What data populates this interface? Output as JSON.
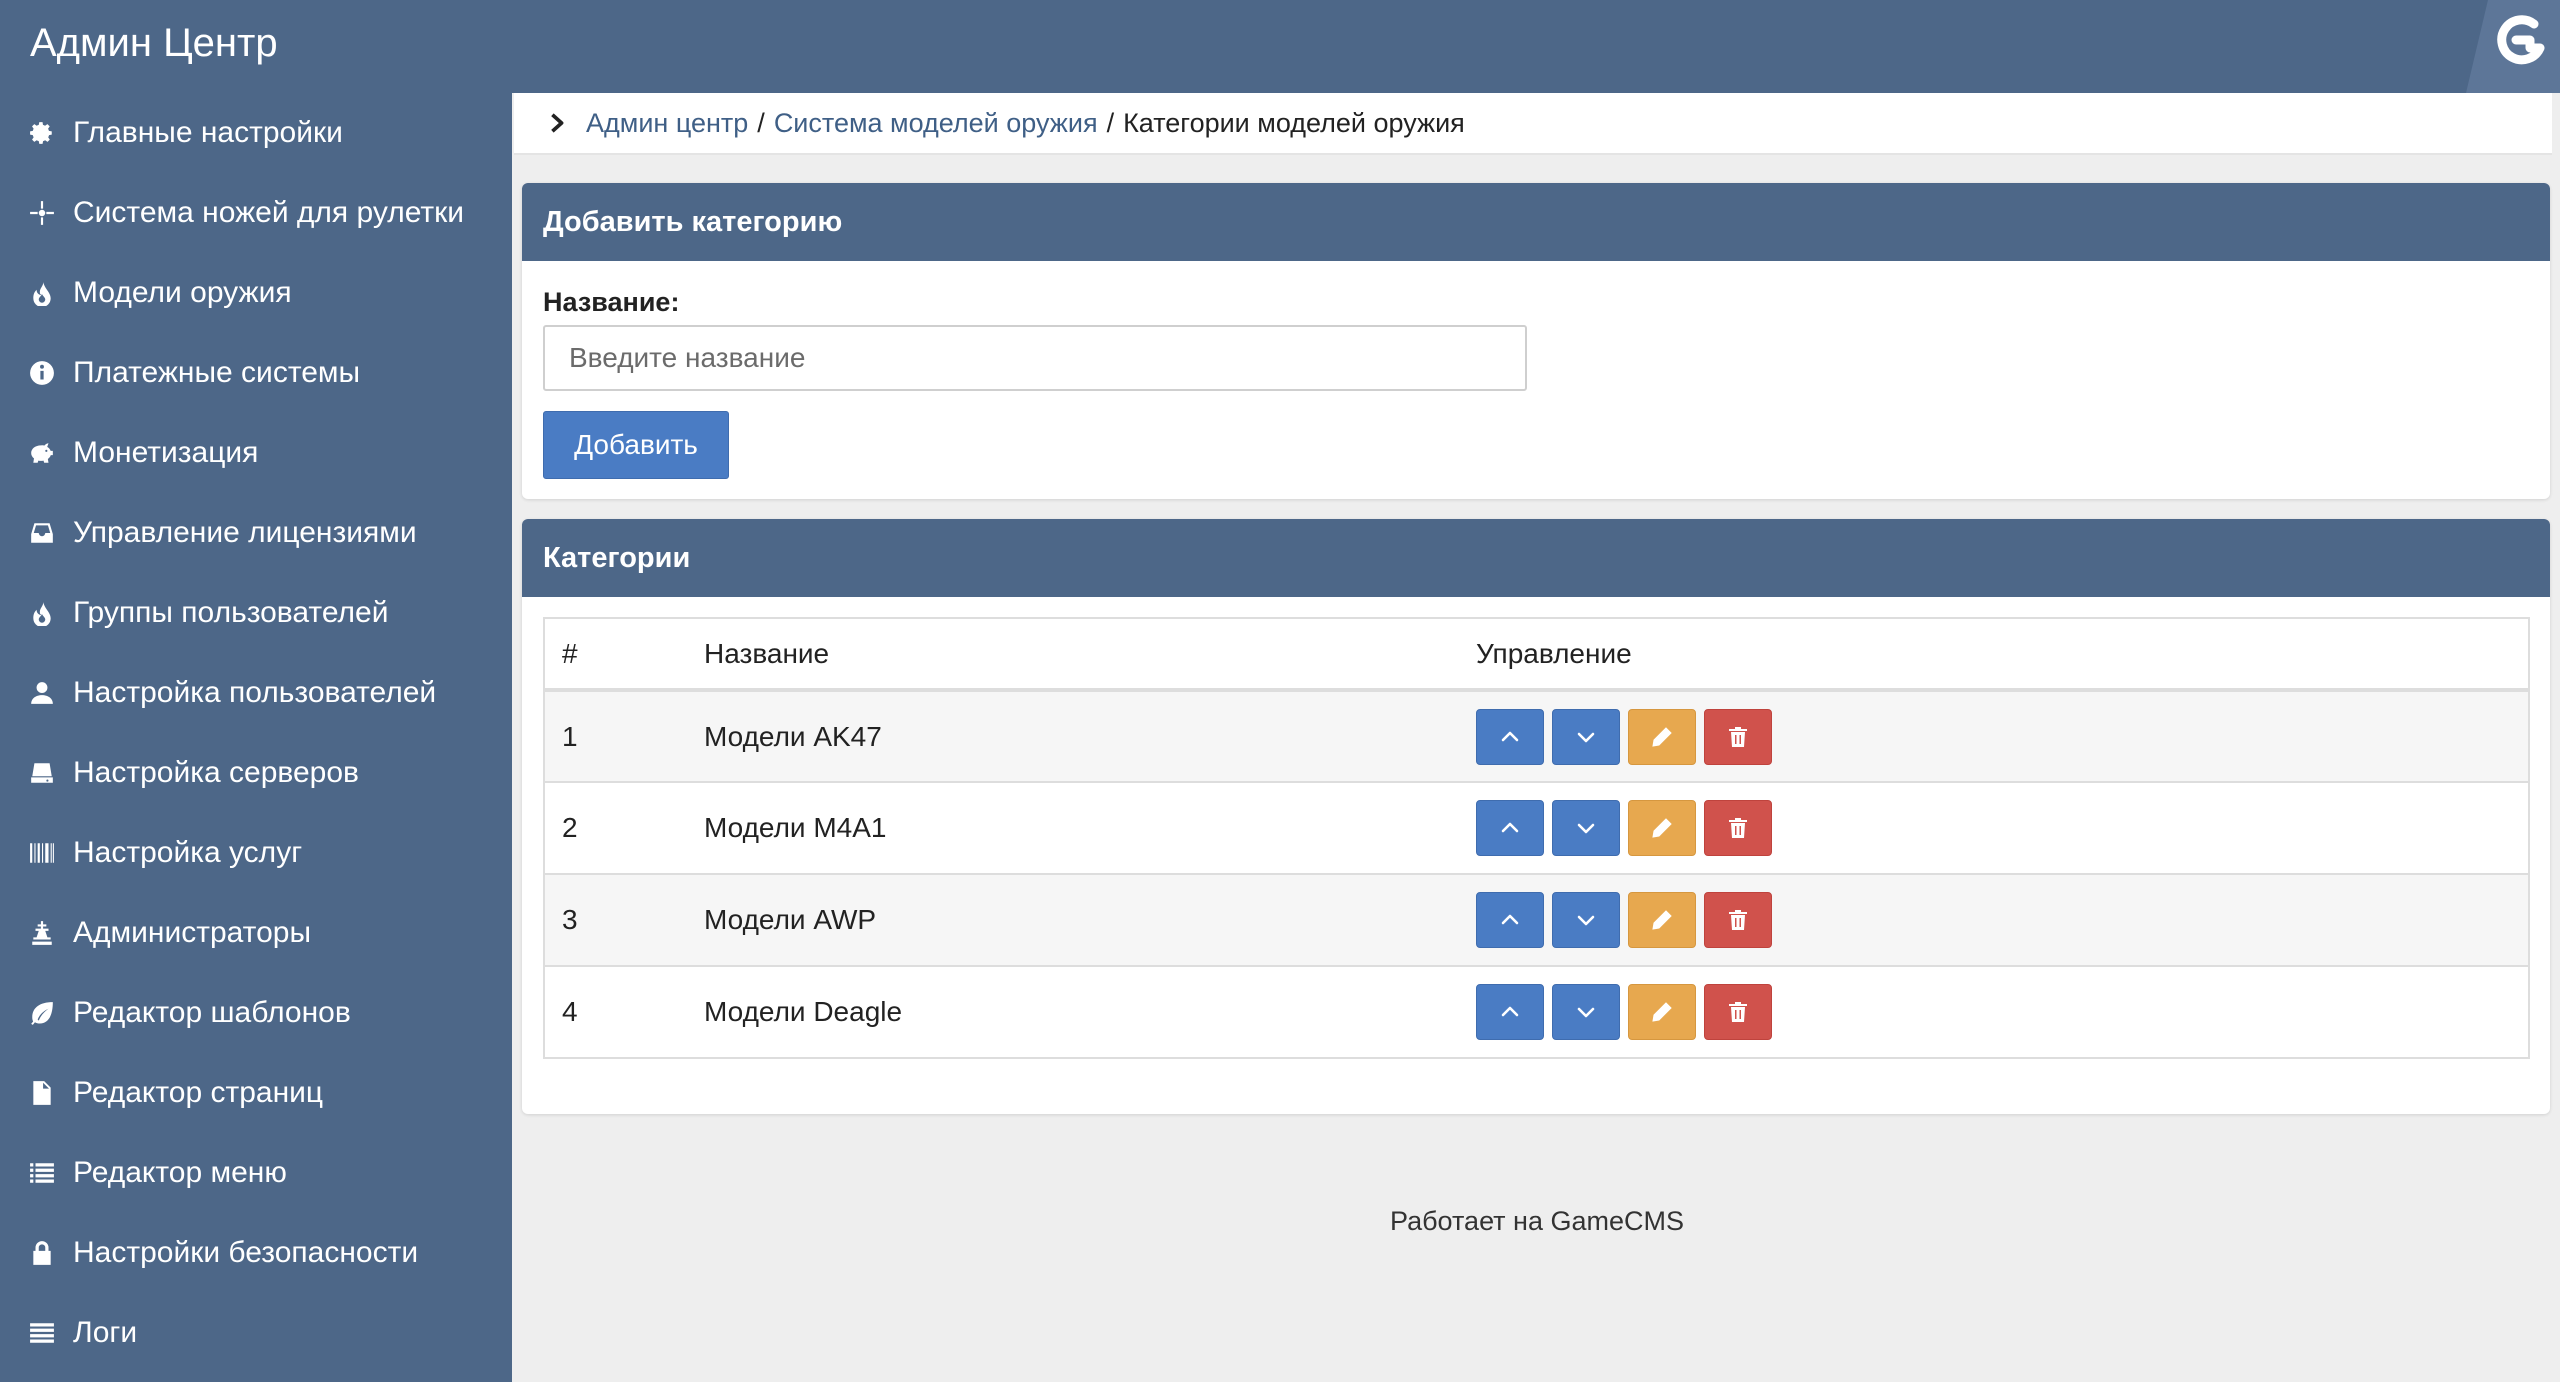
{
  "app": {
    "title": "Админ Центр",
    "logo_icon": "gamecms-g-logo"
  },
  "colors": {
    "header": "#4d6788",
    "primary": "#4a7cc4",
    "warning": "#e7a84f",
    "danger": "#d0524c",
    "link": "#3f5f86"
  },
  "sidebar": {
    "items": [
      {
        "label": "Главные настройки",
        "icon": "gear-icon"
      },
      {
        "label": "Система ножей для рулетки",
        "icon": "crosshair-icon"
      },
      {
        "label": "Модели оружия",
        "icon": "fire-icon"
      },
      {
        "label": "Платежные системы",
        "icon": "info-circle-icon"
      },
      {
        "label": "Монетизация",
        "icon": "piggy-bank-icon"
      },
      {
        "label": "Управление лицензиями",
        "icon": "inbox-icon"
      },
      {
        "label": "Группы пользователей",
        "icon": "fire-icon"
      },
      {
        "label": "Настройка пользователей",
        "icon": "user-icon"
      },
      {
        "label": "Настройка серверов",
        "icon": "server-icon"
      },
      {
        "label": "Настройка услуг",
        "icon": "barcode-icon"
      },
      {
        "label": "Администраторы",
        "icon": "tower-icon"
      },
      {
        "label": "Редактор шаблонов",
        "icon": "leaf-icon"
      },
      {
        "label": "Редактор страниц",
        "icon": "file-icon"
      },
      {
        "label": "Редактор меню",
        "icon": "list-icon"
      },
      {
        "label": "Настройки безопасности",
        "icon": "lock-icon"
      },
      {
        "label": "Логи",
        "icon": "align-justify-icon"
      }
    ]
  },
  "breadcrumb": {
    "items": [
      {
        "label": "Админ центр",
        "link": true
      },
      {
        "label": "Система моделей оружия",
        "link": true
      },
      {
        "label": "Категории моделей оружия",
        "link": false
      }
    ],
    "separator": "/"
  },
  "add_panel": {
    "title": "Добавить категорию",
    "field_label": "Название:",
    "input_value": "",
    "input_placeholder": "Введите название",
    "submit_label": "Добавить"
  },
  "categories_panel": {
    "title": "Категории",
    "columns": [
      "#",
      "Название",
      "Управление"
    ],
    "rows": [
      {
        "num": "1",
        "name": "Модели AK47"
      },
      {
        "num": "2",
        "name": "Модели M4A1"
      },
      {
        "num": "3",
        "name": "Модели AWP"
      },
      {
        "num": "4",
        "name": "Модели Deagle"
      }
    ],
    "row_actions": [
      "chevron-up-icon",
      "chevron-down-icon",
      "pencil-icon",
      "trash-icon"
    ]
  },
  "footer": {
    "text": "Работает на GameCMS"
  }
}
